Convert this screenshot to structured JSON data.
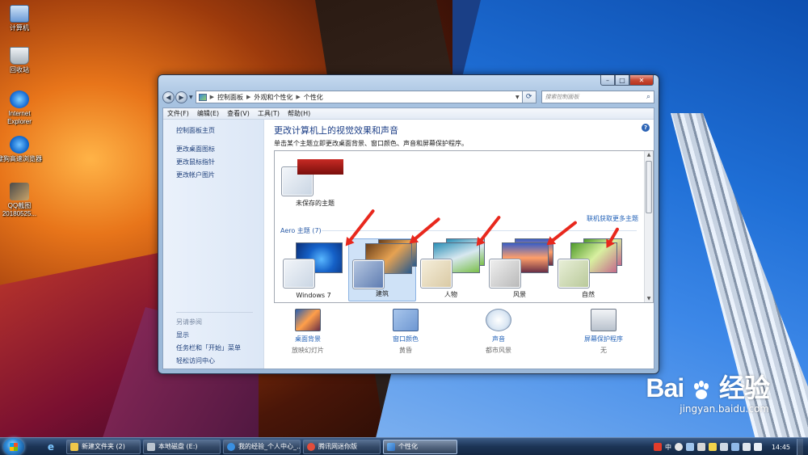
{
  "desktop": {
    "icons": [
      {
        "label": "计算机",
        "icon": "computer-icon"
      },
      {
        "label": "回收站",
        "icon": "recycle-bin-icon"
      },
      {
        "label": "Internet Explorer",
        "icon": "ie-icon"
      },
      {
        "label": "搜狗高速浏览器",
        "icon": "sogou-browser-icon"
      },
      {
        "label": "QQ截图 20180525...",
        "icon": "image-file-icon"
      }
    ]
  },
  "window": {
    "address": {
      "items": [
        "控制面板",
        "外观和个性化",
        "个性化"
      ],
      "search_placeholder": "搜索控制面板"
    },
    "menu": [
      "文件(F)",
      "编辑(E)",
      "查看(V)",
      "工具(T)",
      "帮助(H)"
    ],
    "left_pane": {
      "links": [
        "控制面板主页",
        "更改桌面图标",
        "更改鼠标指针",
        "更改帐户图片"
      ],
      "see_also_title": "另请参阅",
      "see_also": [
        "显示",
        "任务栏和「开始」菜单",
        "轻松访问中心"
      ]
    },
    "main": {
      "title": "更改计算机上的视觉效果和声音",
      "subtitle": "单击某个主题立即更改桌面背景、窗口颜色、声音和屏幕保护程序。",
      "unsaved_theme": "未保存的主题",
      "aero_header": "Aero 主题 (7)",
      "more_themes_link": "联机获取更多主题",
      "themes": [
        {
          "name": "Windows 7",
          "selected": false
        },
        {
          "name": "建筑",
          "selected": true
        },
        {
          "name": "人物",
          "selected": false
        },
        {
          "name": "风景",
          "selected": false
        },
        {
          "name": "自然",
          "selected": false
        }
      ],
      "options": [
        {
          "label": "桌面背景",
          "value": "放映幻灯片",
          "icon": "desktop-background-icon"
        },
        {
          "label": "窗口颜色",
          "value": "黄昏",
          "icon": "window-color-icon"
        },
        {
          "label": "声音",
          "value": "都市风景",
          "icon": "sound-icon"
        },
        {
          "label": "屏幕保护程序",
          "value": "无",
          "icon": "screensaver-icon"
        }
      ]
    }
  },
  "taskbar": {
    "tasks": [
      {
        "label": "新建文件夹 (2)",
        "active": false
      },
      {
        "label": "本地磁盘 (E:)",
        "active": false
      },
      {
        "label": "我的经验_个人中心_...",
        "active": false
      },
      {
        "label": "腾讯网迷你版",
        "active": false
      },
      {
        "label": "个性化",
        "active": true
      }
    ],
    "tray_text": "中",
    "clock": "14:45"
  },
  "watermark": {
    "brand": "Bai",
    "brand_suffix": "经验",
    "url": "jingyan.baidu.com"
  },
  "colors": {
    "accent_link": "#2463b8",
    "title_blue": "#1d3f87",
    "annotation_red": "#e8281d"
  }
}
